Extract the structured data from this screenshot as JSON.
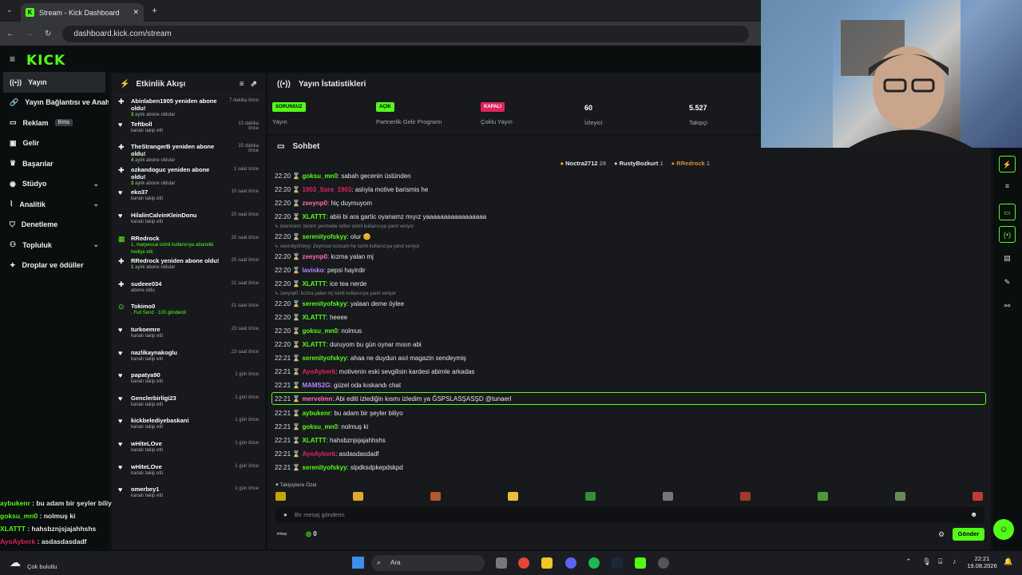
{
  "browser": {
    "tab_title": "Stream - Kick Dashboard",
    "url": "dashboard.kick.com/stream"
  },
  "brand": {
    "logo": "KICK",
    "accent": "#53fc18"
  },
  "sidebar": {
    "items": [
      {
        "label": "Yayın",
        "icon": "broadcast-icon"
      },
      {
        "label": "Yayın Bağlantısı ve Anahtarı",
        "icon": "link-icon"
      },
      {
        "label": "Reklam",
        "icon": "ad-icon",
        "badge": "Beta"
      },
      {
        "label": "Gelir",
        "icon": "money-icon"
      },
      {
        "label": "Başarılar",
        "icon": "trophy-icon"
      },
      {
        "label": "Stüdyo",
        "icon": "studio-icon"
      },
      {
        "label": "Analitik",
        "icon": "chart-icon"
      },
      {
        "label": "Denetleme",
        "icon": "shield-icon"
      },
      {
        "label": "Topluluk",
        "icon": "community-icon"
      },
      {
        "label": "Droplar ve ödüller",
        "icon": "gift-icon"
      }
    ]
  },
  "overlay_chat": [
    {
      "user": "aybukenr",
      "text": "bu adam bir şeyler biliyo",
      "color": "#53fc18"
    },
    {
      "user": "goksu_mn0",
      "text": "nolmuş ki",
      "color": "#53fc18"
    },
    {
      "user": "XLATTT",
      "text": "hahsbznjsjajahhshs",
      "color": "#53fc18"
    },
    {
      "user": "AyoAyberk",
      "text": "asdasdasdadf",
      "color": "#e0245e"
    },
    {
      "user": "serenityofskyy",
      "text": "slpdksdpkepdskpd",
      "color": "#53fc18"
    }
  ],
  "weather": {
    "text": "Çok bulutlu"
  },
  "activity": {
    "title": "Etkinlik Akışı",
    "items": [
      {
        "title": "Abinlaben1905 yeniden abone oldu!",
        "sub": "aylık abone oldular",
        "months": "3",
        "time": "7 dakika önce",
        "icon": "star-icon"
      },
      {
        "title": "Teftboll",
        "sub": "kanalı takip etti",
        "time": "13 dakika önce",
        "icon": "heart-icon"
      },
      {
        "title": "TheStrangerB yeniden abone oldu!",
        "sub": "aylık abone oldular",
        "months": "4",
        "time": "15 dakika önce",
        "icon": "star-icon"
      },
      {
        "title": "ozkandoguc yeniden abone oldu!",
        "sub": "aylık abone oldular",
        "months": "3",
        "time": "1 saat önce",
        "icon": "star-icon"
      },
      {
        "title": "eko37",
        "sub": "kanalı takip etti",
        "time": "10 saat önce",
        "icon": "heart-icon"
      },
      {
        "title": "HilalinCalvinKleinDonu",
        "sub": "kanalı takip etti",
        "time": "20 saat önce",
        "icon": "heart-icon"
      },
      {
        "title": "RRedrock",
        "sub": "1, marpessai isimli kullanıcıya abonelik hediye etti.",
        "time": "20 saat önce",
        "icon": "gift-icon"
      },
      {
        "title": "RRedrock yeniden abone oldu!",
        "sub": "aylık abone oldular",
        "months": "1",
        "time": "20 saat önce",
        "icon": "star-icon"
      },
      {
        "title": "sudeee034",
        "sub": "abone oldu",
        "time": "21 saat önce",
        "icon": "star-icon"
      },
      {
        "title": "Tokimo0",
        "sub": ", Full Send · 100 gönderdi",
        "time": "21 saat önce",
        "icon": "kick-icon"
      },
      {
        "title": "turkoemre",
        "sub": "kanalı takip etti",
        "time": "23 saat önce",
        "icon": "heart-icon"
      },
      {
        "title": "nazlikaynakoglu",
        "sub": "kanalı takip etti",
        "time": "23 saat önce",
        "icon": "heart-icon"
      },
      {
        "title": "papatya90",
        "sub": "kanalı takip etti",
        "time": "1 gün önce",
        "icon": "heart-icon"
      },
      {
        "title": "Genclerbirligi23",
        "sub": "kanalı takip etti",
        "time": "1 gün önce",
        "icon": "heart-icon"
      },
      {
        "title": "kickbelediyebaskani",
        "sub": "kanalı takip etti",
        "time": "1 gün önce",
        "icon": "heart-icon"
      },
      {
        "title": "wHiteLOve",
        "sub": "kanalı takip etti",
        "time": "1 gün önce",
        "icon": "heart-icon"
      },
      {
        "title": "wHiteLOve",
        "sub": "kanalı takip etti",
        "time": "1 gün önce",
        "icon": "heart-icon"
      },
      {
        "title": "omerbey1",
        "sub": "kanalı takip etti",
        "time": "1 gün önce",
        "icon": "heart-icon"
      }
    ]
  },
  "stats": {
    "title": "Yayın İstatistikleri",
    "cols": [
      {
        "badge": "SORUNSUZ",
        "badge_color": "#53fc18",
        "label": "Yayın"
      },
      {
        "badge": "AÇIK",
        "badge_color": "#53fc18",
        "label": "Partnerlik Gelir Programı"
      },
      {
        "badge": "KAPALI",
        "badge_color": "#e0245e",
        "label": "Çoklu Yayın"
      },
      {
        "value": "60",
        "label": "İzleyici"
      },
      {
        "value": "5.527",
        "label": "Takipçi"
      }
    ]
  },
  "chat": {
    "title": "Sohbet",
    "pinned": [
      {
        "name": "Noctra2712",
        "count": "28"
      },
      {
        "name": "RustyBozkurt",
        "count": "1"
      },
      {
        "name": "RRedrock",
        "count": "1"
      }
    ],
    "messages": [
      {
        "kind": "msg",
        "time": "22:20",
        "user": "goksu_mn0",
        "color": "#53fc18",
        "text": "sabah gecenin üstünden"
      },
      {
        "kind": "msg",
        "time": "22:20",
        "user": "1903_Sare_1903",
        "color": "#e0245e",
        "text": "aslıyla motive barismis he"
      },
      {
        "kind": "msg",
        "time": "22:20",
        "user": "zeeynp0",
        "color": "#ff69b4",
        "text": "hiç duymuyom"
      },
      {
        "kind": "msg",
        "time": "22:20",
        "user": "XLATTT",
        "color": "#53fc18",
        "text": "abiii bi ara gartic oyanamz mıyız yaaaaaaaaaaaaaaaaa"
      },
      {
        "kind": "reply",
        "text": "istemirem: benim yerimede lutfen isimli kullanıcıya yanıt veriyor"
      },
      {
        "kind": "msg",
        "time": "22:20",
        "user": "serenityofskyy",
        "color": "#53fc18",
        "text": "olur 😊"
      },
      {
        "kind": "reply",
        "text": "serenityofskyy: Zeynooo kızıcam he isimli kullanıcıya yanıt veriyor"
      },
      {
        "kind": "msg",
        "time": "22:20",
        "user": "zeeynp0",
        "color": "#ff69b4",
        "text": "kızma yalan mj"
      },
      {
        "kind": "msg",
        "time": "22:20",
        "user": "lavisko",
        "color": "#b388ff",
        "text": "pepsi hayirdir"
      },
      {
        "kind": "msg",
        "time": "22:20",
        "user": "XLATTT",
        "color": "#53fc18",
        "text": "ice tea nerde"
      },
      {
        "kind": "reply",
        "text": "zeeynp0: kızma yalan mj isimli kullanıcıya yanıt veriyor"
      },
      {
        "kind": "msg",
        "time": "22:20",
        "user": "serenityofskyy",
        "color": "#53fc18",
        "text": "yalaan deme öylee"
      },
      {
        "kind": "msg",
        "time": "22:20",
        "user": "XLATTT",
        "color": "#53fc18",
        "text": "heeee"
      },
      {
        "kind": "msg",
        "time": "22:20",
        "user": "goksu_mn0",
        "color": "#53fc18",
        "text": "nolmus"
      },
      {
        "kind": "msg",
        "time": "22:20",
        "user": "XLATTT",
        "color": "#53fc18",
        "text": "duruyom bu gün oynar mısın abi"
      },
      {
        "kind": "msg",
        "time": "22:21",
        "user": "serenityofskyy",
        "color": "#53fc18",
        "text": "ahaa ne duydun asıl magazin sendeymiş"
      },
      {
        "kind": "msg",
        "time": "22:21",
        "user": "AyoAyberk",
        "color": "#e0245e",
        "text": "motivenin eski sevgilisin kardesi abimle arkadas"
      },
      {
        "kind": "msg",
        "time": "22:21",
        "user": "MAMS2G",
        "color": "#b388ff",
        "text": "güzel oda kıskandı chat"
      },
      {
        "kind": "msg",
        "time": "22:21",
        "user": "mervelmn",
        "color": "#ff69b4",
        "text": "Abi editi izlediğin kısmı izledim ya ĞSPSLASŞASŞD @tunaerl",
        "highlight": true
      },
      {
        "kind": "msg",
        "time": "22:21",
        "user": "aybukenr",
        "color": "#53fc18",
        "text": "bu adam bir şeyler biliyo"
      },
      {
        "kind": "msg",
        "time": "22:21",
        "user": "goksu_mn0",
        "color": "#53fc18",
        "text": "nolmuş ki"
      },
      {
        "kind": "msg",
        "time": "22:21",
        "user": "XLATTT",
        "color": "#53fc18",
        "text": "hahsbznjsjajahhshs"
      },
      {
        "kind": "msg",
        "time": "22:21",
        "user": "AyoAyberk",
        "color": "#e0245e",
        "text": "asdasdasdadf"
      },
      {
        "kind": "msg",
        "time": "22:21",
        "user": "serenityofskyy",
        "color": "#53fc18",
        "text": "slpdksdpkepdskpd"
      }
    ],
    "followers_only": "Takipçilere Özel",
    "input_placeholder": "Bir mesaj gönderin",
    "points": "0",
    "send": "Gönder"
  },
  "taskbar": {
    "search": "Ara",
    "time": "22:21",
    "date": "19.08.2026"
  }
}
